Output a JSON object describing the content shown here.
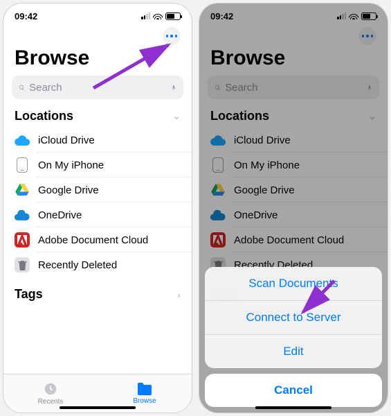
{
  "status": {
    "time": "09:42"
  },
  "screen": {
    "title": "Browse",
    "search_placeholder": "Search",
    "locations_header": "Locations",
    "tags_header": "Tags",
    "locations": [
      {
        "label": "iCloud Drive",
        "icon": "cloud-icon"
      },
      {
        "label": "On My iPhone",
        "icon": "phone-icon"
      },
      {
        "label": "Google Drive",
        "icon": "gdrive-icon"
      },
      {
        "label": "OneDrive",
        "icon": "onedrive-icon"
      },
      {
        "label": "Adobe Document Cloud",
        "icon": "adobe-icon"
      },
      {
        "label": "Recently Deleted",
        "icon": "trash-icon"
      }
    ]
  },
  "tabbar": {
    "recents": "Recents",
    "browse": "Browse"
  },
  "actionsheet": {
    "items": [
      "Scan Documents",
      "Connect to Server",
      "Edit"
    ],
    "cancel": "Cancel"
  }
}
